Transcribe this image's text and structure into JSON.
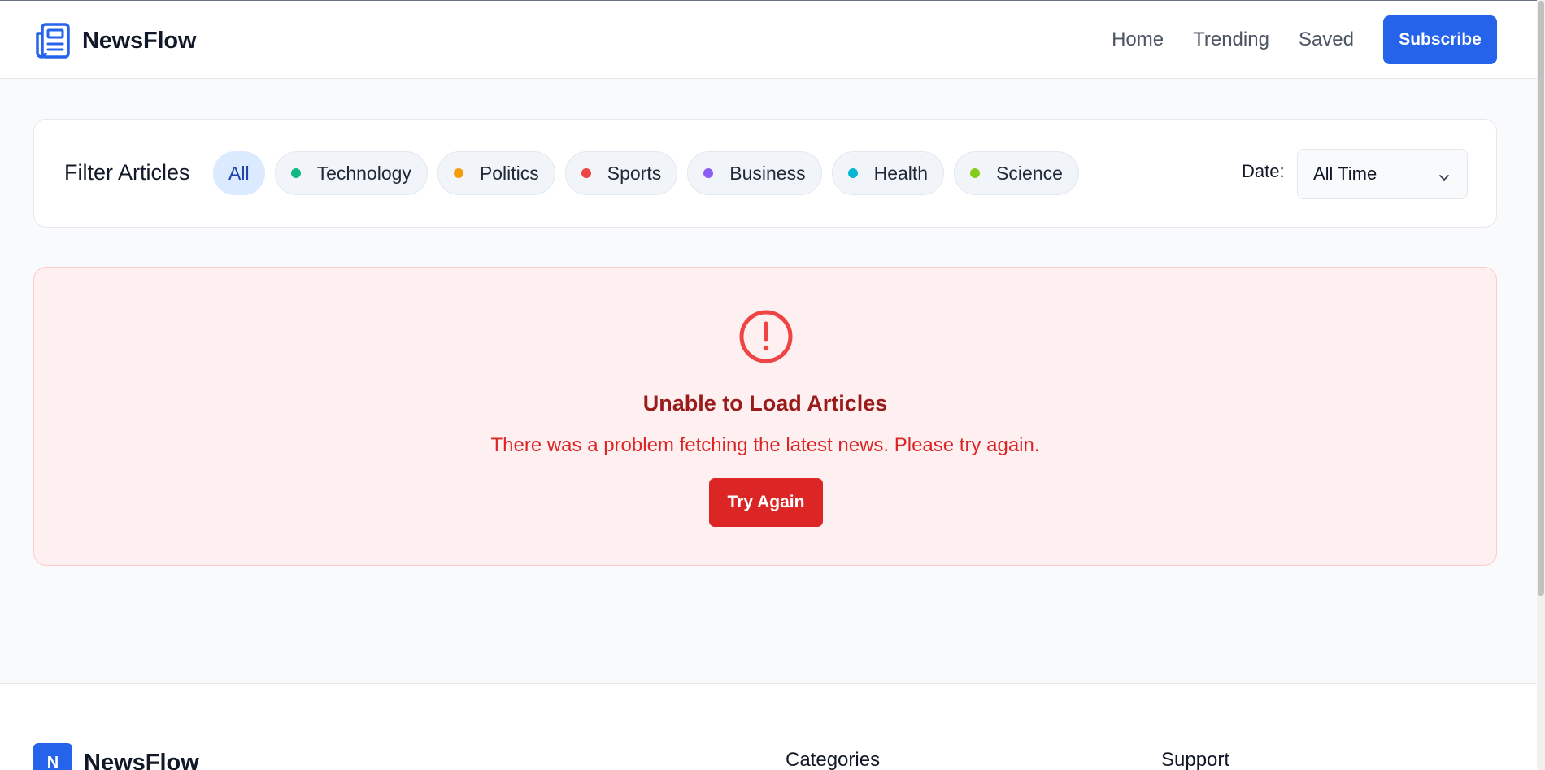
{
  "header": {
    "brand": "NewsFlow",
    "nav": [
      "Home",
      "Trending",
      "Saved"
    ],
    "subscribe_label": "Subscribe"
  },
  "filters": {
    "title": "Filter Articles",
    "chips": [
      {
        "label": "All",
        "active": true,
        "color": null
      },
      {
        "label": "Technology",
        "active": false,
        "color": "#10b981"
      },
      {
        "label": "Politics",
        "active": false,
        "color": "#f59e0b"
      },
      {
        "label": "Sports",
        "active": false,
        "color": "#ef4444"
      },
      {
        "label": "Business",
        "active": false,
        "color": "#8b5cf6"
      },
      {
        "label": "Health",
        "active": false,
        "color": "#06b6d4"
      },
      {
        "label": "Science",
        "active": false,
        "color": "#84cc16"
      }
    ],
    "date_label": "Date:",
    "date_value": "All Time"
  },
  "error": {
    "icon": "alert-circle-icon",
    "title": "Unable to Load Articles",
    "message": "There was a problem fetching the latest news. Please try again.",
    "retry_label": "Try Again"
  },
  "footer": {
    "badge": "N",
    "brand": "NewsFlow",
    "col_categories": "Categories",
    "col_support": "Support"
  },
  "colors": {
    "accent": "#2563eb",
    "error": "#dc2626",
    "error_title": "#991b1b",
    "error_bg": "#fef0f0"
  }
}
